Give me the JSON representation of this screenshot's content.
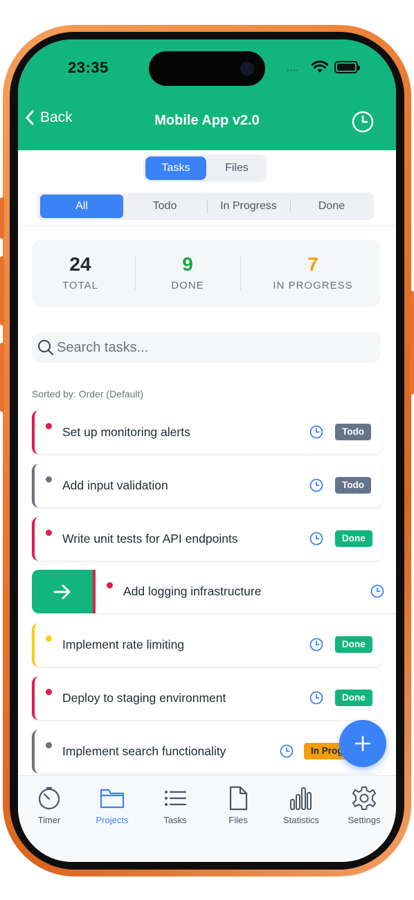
{
  "status_bar": {
    "time": "23:35",
    "dots": "••••"
  },
  "header": {
    "back_label": "Back",
    "title": "Mobile App v2.0"
  },
  "main_tabs": [
    {
      "label": "Tasks",
      "active": true
    },
    {
      "label": "Files",
      "active": false
    }
  ],
  "filters": [
    {
      "label": "All",
      "active": true
    },
    {
      "label": "Todo",
      "active": false
    },
    {
      "label": "In Progress",
      "active": false
    },
    {
      "label": "Done",
      "active": false
    }
  ],
  "stats": {
    "total": {
      "value": "24",
      "label": "TOTAL",
      "color": "#1f2937"
    },
    "done": {
      "value": "9",
      "label": "DONE",
      "color": "#16a34a"
    },
    "in_progress": {
      "value": "7",
      "label": "IN PROGRESS",
      "color": "#f59e0b"
    }
  },
  "search": {
    "placeholder": "Search tasks..."
  },
  "sort_label": "Sorted by: Order (Default)",
  "tasks": [
    {
      "title": "Set up monitoring alerts",
      "status": "Todo",
      "priority_color": "#e11d48",
      "badge_color": "#64748b"
    },
    {
      "title": "Add input validation",
      "status": "Todo",
      "priority_color": "#6b7280",
      "badge_color": "#64748b"
    },
    {
      "title": "Write unit tests for API endpoints",
      "status": "Done",
      "priority_color": "#e11d48",
      "badge_color": "#12b57d"
    },
    {
      "title": "Add logging infrastructure",
      "status": "",
      "priority_color": "#e11d48",
      "badge_color": ""
    },
    {
      "title": "Implement rate limiting",
      "status": "Done",
      "priority_color": "#facc15",
      "badge_color": "#12b57d"
    },
    {
      "title": "Deploy to staging environment",
      "status": "Done",
      "priority_color": "#e11d48",
      "badge_color": "#12b57d"
    },
    {
      "title": "Implement search functionality",
      "status": "In Prog",
      "priority_color": "#6b7280",
      "badge_color": "#f59e0b"
    }
  ],
  "bottom_nav": [
    {
      "label": "Timer",
      "icon": "timer-icon",
      "active": false
    },
    {
      "label": "Projects",
      "icon": "folder-icon",
      "active": true
    },
    {
      "label": "Tasks",
      "icon": "list-icon",
      "active": false
    },
    {
      "label": "Files",
      "icon": "file-icon",
      "active": false
    },
    {
      "label": "Statistics",
      "icon": "bar-chart-icon",
      "active": false
    },
    {
      "label": "Settings",
      "icon": "gear-icon",
      "active": false
    }
  ],
  "colors": {
    "header": "#12b57d",
    "accent": "#3b82f6",
    "frame": "#e9782e"
  }
}
